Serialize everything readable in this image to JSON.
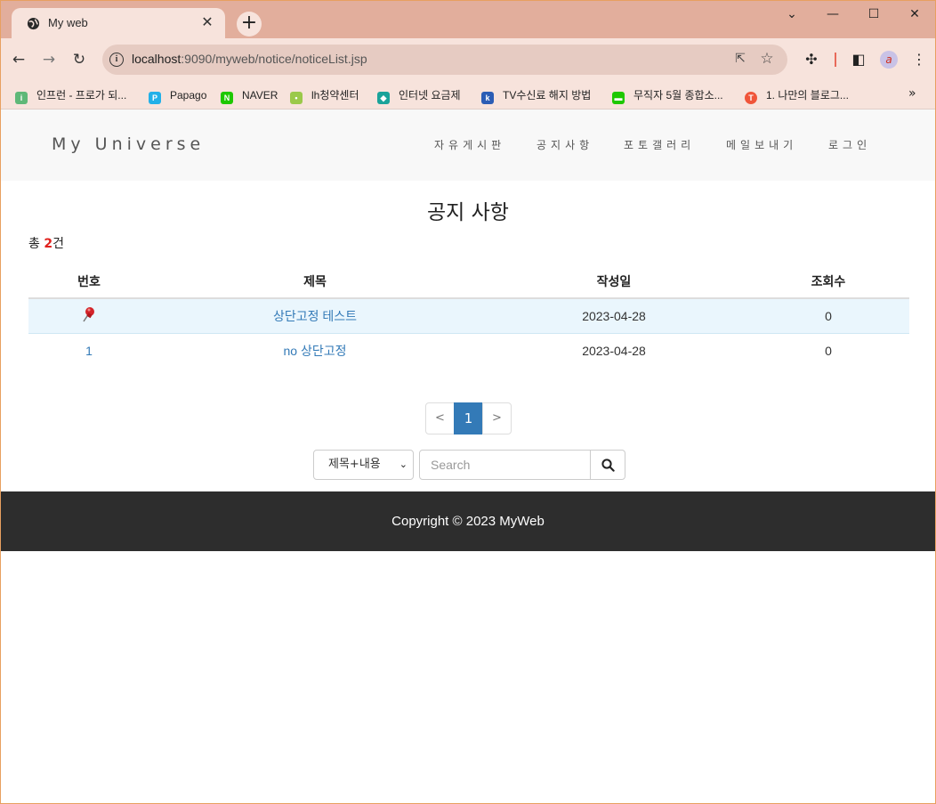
{
  "browser": {
    "tab_title": "My web",
    "url_host": "localhost",
    "url_rest": ":9090/myweb/notice/noticeList.jsp",
    "bookmarks": [
      {
        "label": "인프런 - 프로가 되...",
        "color": "#5fb878",
        "glyph": "i"
      },
      {
        "label": "Papago",
        "color": "#22b0e8",
        "glyph": "P"
      },
      {
        "label": "NAVER",
        "color": "#1ec800",
        "glyph": "N"
      },
      {
        "label": "lh청약센터",
        "color": "#9bc94a",
        "glyph": "•"
      },
      {
        "label": "인터넷 요금제",
        "color": "#1aa39a",
        "glyph": "◆"
      },
      {
        "label": "TV수신료 해지 방법",
        "color": "#2b5db5",
        "glyph": "k"
      },
      {
        "label": "무직자 5월 종합소...",
        "color": "#1ec800",
        "glyph": "▬"
      },
      {
        "label": "1. 나만의 블로그...",
        "color": "#f0553a",
        "glyph": "T"
      }
    ]
  },
  "site": {
    "brand": "My Universe",
    "menu": [
      "자유게시판",
      "공지사항",
      "포토갤러리",
      "메일보내기",
      "로그인"
    ]
  },
  "notice": {
    "title": "공지 사항",
    "total_prefix": "총 ",
    "total_count": "2",
    "total_suffix": "건",
    "headers": {
      "num": "번호",
      "title": "제목",
      "date": "작성일",
      "views": "조회수"
    },
    "rows": [
      {
        "num": "",
        "title": "상단고정 테스트",
        "date": "2023-04-28",
        "views": "0",
        "pinned": true
      },
      {
        "num": "1",
        "title": "no 상단고정",
        "date": "2023-04-28",
        "views": "0",
        "pinned": false
      }
    ]
  },
  "pagination": {
    "prev": "<",
    "current": "1",
    "next": ">"
  },
  "search": {
    "option_selected": "제목+내용",
    "placeholder": "Search"
  },
  "footer": {
    "copyright": "Copyright © 2023 MyWeb"
  }
}
